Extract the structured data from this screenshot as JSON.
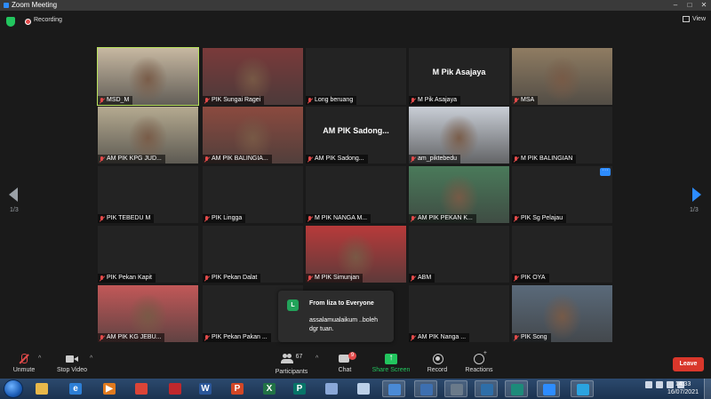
{
  "window": {
    "title": "Zoom Meeting"
  },
  "topbar": {
    "recording_label": "Recording",
    "view_label": "View"
  },
  "pager": {
    "left": "1/3",
    "right": "1/3"
  },
  "tiles": [
    {
      "name": "MSD_M",
      "video": true,
      "active": true,
      "bg": "#c7b8a1"
    },
    {
      "name": "PIK Sungai Ragei",
      "video": true,
      "bg": "#7a3a3a"
    },
    {
      "name": "Long beruang",
      "video": false
    },
    {
      "name": "M Pik Asajaya",
      "video": false,
      "big": "M Pik Asajaya"
    },
    {
      "name": "MSA",
      "video": true,
      "bg": "#8f7c62"
    },
    {
      "name": "AM PIK KPG JUD...",
      "video": true,
      "bg": "#b5aa90"
    },
    {
      "name": "AM PIK BALINGIA...",
      "video": true,
      "bg": "#8b4a3f"
    },
    {
      "name": "AM PIK Sadong...",
      "video": false,
      "big": "AM PIK  Sadong..."
    },
    {
      "name": "am_piktebedu",
      "video": true,
      "bg": "#c9ced6"
    },
    {
      "name": "M PIK BALINGIAN",
      "video": false
    },
    {
      "name": "PIK TEBEDU M",
      "video": false
    },
    {
      "name": "PIK Lingga",
      "video": false
    },
    {
      "name": "M PIK NANGA M...",
      "video": false
    },
    {
      "name": "AM PIK PEKAN K...",
      "video": true,
      "bg": "#4a7a5a"
    },
    {
      "name": "PIK Sg Pelajau",
      "video": false,
      "more": true
    },
    {
      "name": "PIK Pekan Kapit",
      "video": false
    },
    {
      "name": "PIK Pekan Dalat",
      "video": false
    },
    {
      "name": "M PIK Simunjan",
      "video": true,
      "bg": "#b83a3a"
    },
    {
      "name": "ABM",
      "video": false
    },
    {
      "name": "PIK OYA",
      "video": false
    },
    {
      "name": "AM PIK KG JEBU...",
      "video": true,
      "bg": "#c25858"
    },
    {
      "name": "PIK Pekan Pakan ...",
      "video": false
    },
    {
      "name": "",
      "video": false,
      "hidden": true
    },
    {
      "name": "AM PIK Nanga ...",
      "video": false
    },
    {
      "name": "PIK Song",
      "video": true,
      "bg": "#5a6a7a"
    }
  ],
  "chat_popup": {
    "avatar_letter": "L",
    "from": "From liza to Everyone",
    "message": "assalamualaikum ..boleh dgr tuan."
  },
  "controls": {
    "unmute": "Unmute",
    "stop_video": "Stop Video",
    "participants": "Participants",
    "participants_count": "67",
    "chat": "Chat",
    "chat_badge": "9",
    "share_screen": "Share Screen",
    "record": "Record",
    "reactions": "Reactions",
    "leave": "Leave"
  },
  "taskbar": {
    "time": "14:33",
    "date": "16/07/2021",
    "apps": [
      {
        "name": "file-explorer-icon",
        "color": "#e8b84a",
        "glyph": ""
      },
      {
        "name": "internet-explorer-icon",
        "color": "#2d7fd6",
        "glyph": "e"
      },
      {
        "name": "media-player-icon",
        "color": "#e07a1e",
        "glyph": "▶"
      },
      {
        "name": "chrome-icon",
        "color": "#db4437",
        "glyph": ""
      },
      {
        "name": "pdf-reader-icon",
        "color": "#c0282d",
        "glyph": ""
      },
      {
        "name": "word-icon",
        "color": "#2b579a",
        "glyph": "W"
      },
      {
        "name": "powerpoint-icon",
        "color": "#d24726",
        "glyph": "P"
      },
      {
        "name": "excel-icon",
        "color": "#217346",
        "glyph": "X"
      },
      {
        "name": "publisher-icon",
        "color": "#077568",
        "glyph": "P"
      },
      {
        "name": "paint-icon",
        "color": "#8aa8d8",
        "glyph": ""
      },
      {
        "name": "notepad-icon",
        "color": "#bcd0e8",
        "glyph": ""
      },
      {
        "name": "network-icon",
        "color": "#4a8ad6",
        "glyph": ""
      },
      {
        "name": "globe-icon",
        "color": "#3d6fb0",
        "glyph": ""
      },
      {
        "name": "hourglass-icon",
        "color": "#6a7a8a",
        "glyph": ""
      },
      {
        "name": "capture-icon",
        "color": "#2e6ea8",
        "glyph": ""
      },
      {
        "name": "camtasia-icon",
        "color": "#1d8a7a",
        "glyph": ""
      },
      {
        "name": "zoom-icon",
        "color": "#2d8cff",
        "glyph": ""
      },
      {
        "name": "telegram-icon",
        "color": "#2aa3e0",
        "glyph": ""
      }
    ]
  }
}
